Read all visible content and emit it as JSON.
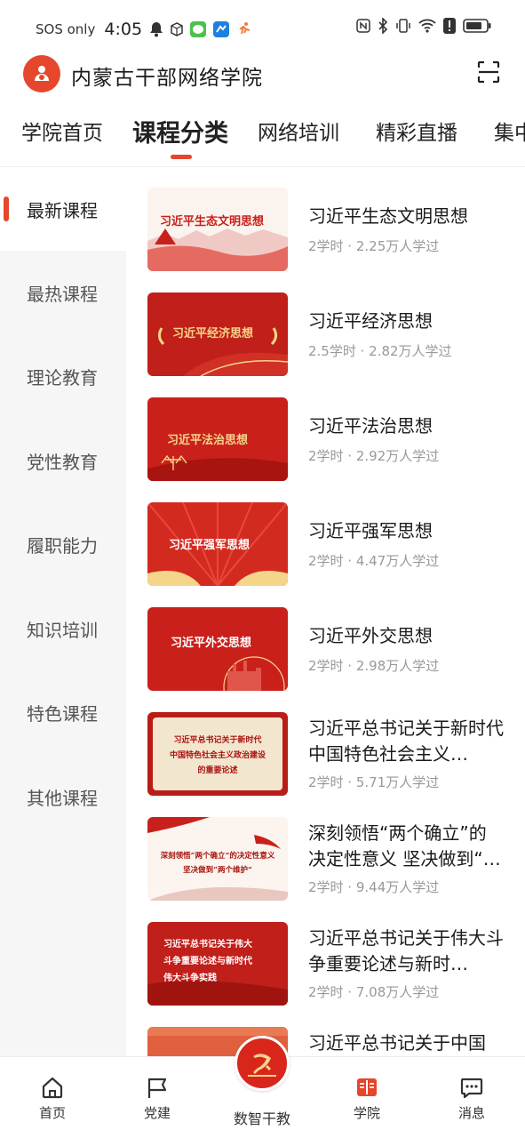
{
  "status_bar": {
    "sos": "SOS only",
    "time": "4:05"
  },
  "header": {
    "title": "内蒙古干部网络学院",
    "logo_icon": "party-member-logo-icon",
    "scan_icon": "scan-icon"
  },
  "top_tabs": [
    {
      "label": "学院首页"
    },
    {
      "label": "课程分类"
    },
    {
      "label": "网络培训"
    },
    {
      "label": "精彩直播"
    },
    {
      "label": "集中"
    }
  ],
  "sidebar": {
    "items": [
      {
        "label": "最新课程"
      },
      {
        "label": "最热课程"
      },
      {
        "label": "理论教育"
      },
      {
        "label": "党性教育"
      },
      {
        "label": "履职能力"
      },
      {
        "label": "知识培训"
      },
      {
        "label": "特色课程"
      },
      {
        "label": "其他课程"
      }
    ]
  },
  "courses": [
    {
      "title": "习近平生态文明思想",
      "meta": "2学时 · 2.25万人学过",
      "thumb_text": "习近平生态文明思想"
    },
    {
      "title": "习近平经济思想",
      "meta": "2.5学时 · 2.82万人学过",
      "thumb_text": "习近平经济思想"
    },
    {
      "title": "习近平法治思想",
      "meta": "2学时 · 2.92万人学过",
      "thumb_text": "习近平法治思想"
    },
    {
      "title": "习近平强军思想",
      "meta": "2学时 · 4.47万人学过",
      "thumb_text": "习近平强军思想"
    },
    {
      "title": "习近平外交思想",
      "meta": "2学时 · 2.98万人学过",
      "thumb_text": "习近平外交思想"
    },
    {
      "title": "习近平总书记关于新时代中国特色社会主义…",
      "meta": "2学时 · 5.71万人学过",
      "thumb_lines": [
        "习近平总书记关于新时代",
        "中国特色社会主义政治建设",
        "的重要论述"
      ]
    },
    {
      "title": "深刻领悟“两个确立”的决定性意义 坚决做到“…",
      "meta": "2学时 · 9.44万人学过",
      "thumb_lines": [
        "深刻领悟“两个确立”的决定性意义",
        "坚决做到“两个维护”"
      ]
    },
    {
      "title": "习近平总书记关于伟大斗争重要论述与新时…",
      "meta": "2学时 · 7.08万人学过",
      "thumb_lines": [
        "习近平总书记关于伟大",
        "斗争重要论述与新时代",
        "伟大斗争实践"
      ]
    },
    {
      "title": "习近平总书记关于中国",
      "meta": ""
    }
  ],
  "bottom_nav": [
    {
      "label": "首页",
      "icon": "home-icon"
    },
    {
      "label": "党建",
      "icon": "flag-icon"
    },
    {
      "label": "数智干教",
      "icon": "party-emblem-icon"
    },
    {
      "label": "学院",
      "icon": "book-icon"
    },
    {
      "label": "消息",
      "icon": "message-icon"
    }
  ],
  "colors": {
    "accent": "#e5462c",
    "thumb_red": "#c9201b",
    "thumb_gold": "#f5d58a"
  }
}
